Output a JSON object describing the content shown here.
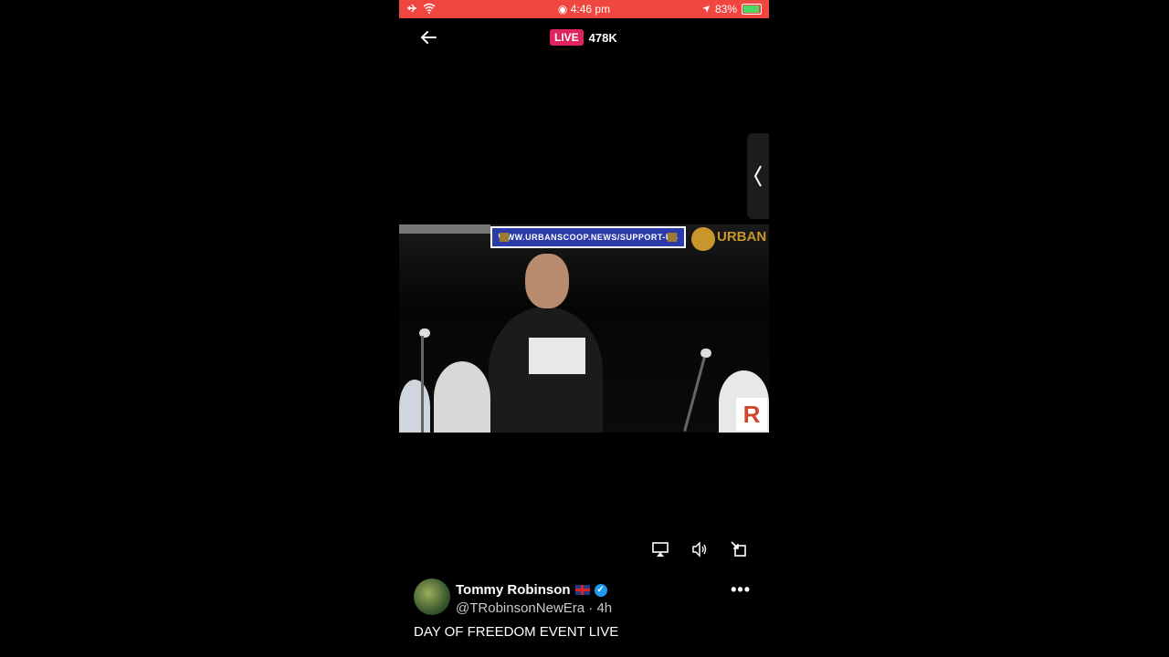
{
  "status_bar": {
    "time": "4:46 pm",
    "battery": "83%",
    "battery_level": 0.83
  },
  "header": {
    "live_badge": "LIVE",
    "viewer_count": "478K"
  },
  "video": {
    "banner_text": "WWW.URBANSCOOP.NEWS/SUPPORT-US",
    "logo_text": "URBAN",
    "corner_logo": "R"
  },
  "tweet": {
    "author_name": "Tommy Robinson",
    "handle": "@TRobinsonNewEra",
    "separator": "·",
    "time_ago": "4h",
    "text": "DAY OF FREEDOM EVENT LIVE",
    "more": "•••"
  },
  "icons": {
    "back": "arrow-left-icon",
    "side_tab": "chevron-left-icon",
    "airplay": "airplay-icon",
    "volume": "volume-icon",
    "minimize": "minimize-icon"
  },
  "colors": {
    "status_bar": "#ef4640",
    "live_badge": "#e0245e",
    "verified": "#1d9bf0"
  }
}
